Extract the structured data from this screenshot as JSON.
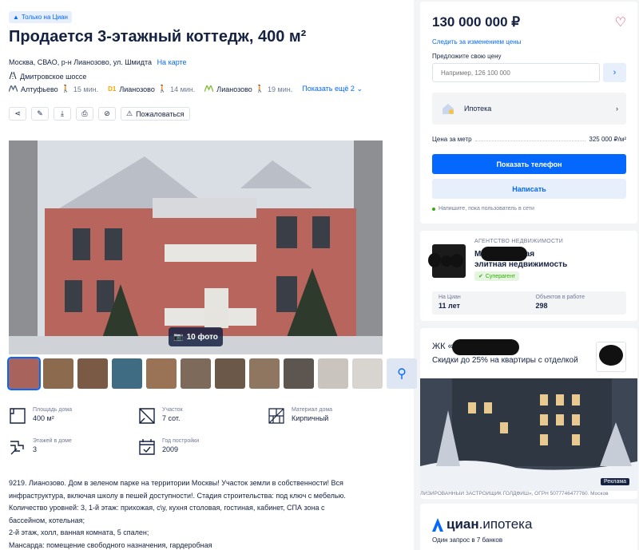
{
  "listing": {
    "badge": "Только на Циан",
    "title": "Продается 3-этажный коттедж, 400 м²",
    "address": "Москва, СВАО, р-н Лианозово, ул. Шмидта",
    "map_link": "На карте",
    "highway": "Дмитровское шоссе",
    "stations": [
      {
        "icon": "metro-icon",
        "name": "Алтуфьево",
        "time": "15 мин.",
        "color": "#5a6e82"
      },
      {
        "icon": "rail-d1-icon",
        "name": "Лианозово",
        "time": "14 мин.",
        "color": "#f6a500"
      },
      {
        "icon": "metro-icon",
        "name": "Лианозово",
        "time": "19 мин.",
        "color": "#86c041"
      }
    ],
    "show_more": "Показать ещё 2",
    "complain": "Пожаловаться",
    "photo_count": "10 фото"
  },
  "specs": [
    {
      "icon": "area-icon",
      "label": "Площадь дома",
      "value": "400 м²"
    },
    {
      "icon": "plot-icon",
      "label": "Участок",
      "value": "7 сот."
    },
    {
      "icon": "material-icon",
      "label": "Материал дома",
      "value": "Кирпичный"
    },
    {
      "icon": "floors-icon",
      "label": "Этажей в доме",
      "value": "3"
    },
    {
      "icon": "calendar-icon",
      "label": "Год постройки",
      "value": "2009"
    }
  ],
  "description": [
    "9219. Лианозово. Дом в зеленом парке на территории Москвы! Участок земли в собственности! Вся",
    "инфраструктура, включая школу в пешей доступности!. Стадия строительства: под ключ с мебелью.",
    "Количество уровней: 3, 1-й этаж: прихожая, с\\у, кухня столовая, гостиная, кабинет, СПА зона с",
    "бассейном, котельная;",
    "2-й этаж, холл, ванная комната, 5 спален;",
    "Мансарда: помещение свободного назначения, гардеробная"
  ],
  "price_card": {
    "price": "130 000 000 ₽",
    "follow": "Следить за изменением цены",
    "offer_label": "Предложите свою цену",
    "offer_placeholder": "Например, 126 100 000",
    "mortgage": "Ипотека",
    "per_meter_label": "Цена за метр",
    "per_meter_value": "325 000 ₽/м²",
    "call": "Показать телефон",
    "write": "Написать",
    "online_note": "Напишите, пока пользователь в сети"
  },
  "agency": {
    "type": "АГЕНТСТВО НЕДВИЖИМОСТИ",
    "name_line1": "М                   - Загородная",
    "name_line2": "элитная недвижимость",
    "super": "Суперагент",
    "years_label": "На Циан",
    "years_value": "11 лет",
    "objects_label": "Объектов в работе",
    "objects_value": "298"
  },
  "ad": {
    "title": "ЖК «                вский»",
    "subtitle": "Скидки до 25% на квартиры с отделкой",
    "mark": "Реклама",
    "legal": "ЛИЗИРОВАННЫЙ ЗАСТРОЙЩИК ГОЛДФИШ», ОГРН 5077746477760. Москов"
  },
  "cian_ipoteka": {
    "brand_bold": "циан",
    "brand_thin": ".ипотека",
    "note": "Один запрос в 7 банков"
  },
  "colors": {
    "accent": "#0468ff",
    "text": "#152242",
    "muted": "#707a95",
    "heart": "#e0254f"
  }
}
